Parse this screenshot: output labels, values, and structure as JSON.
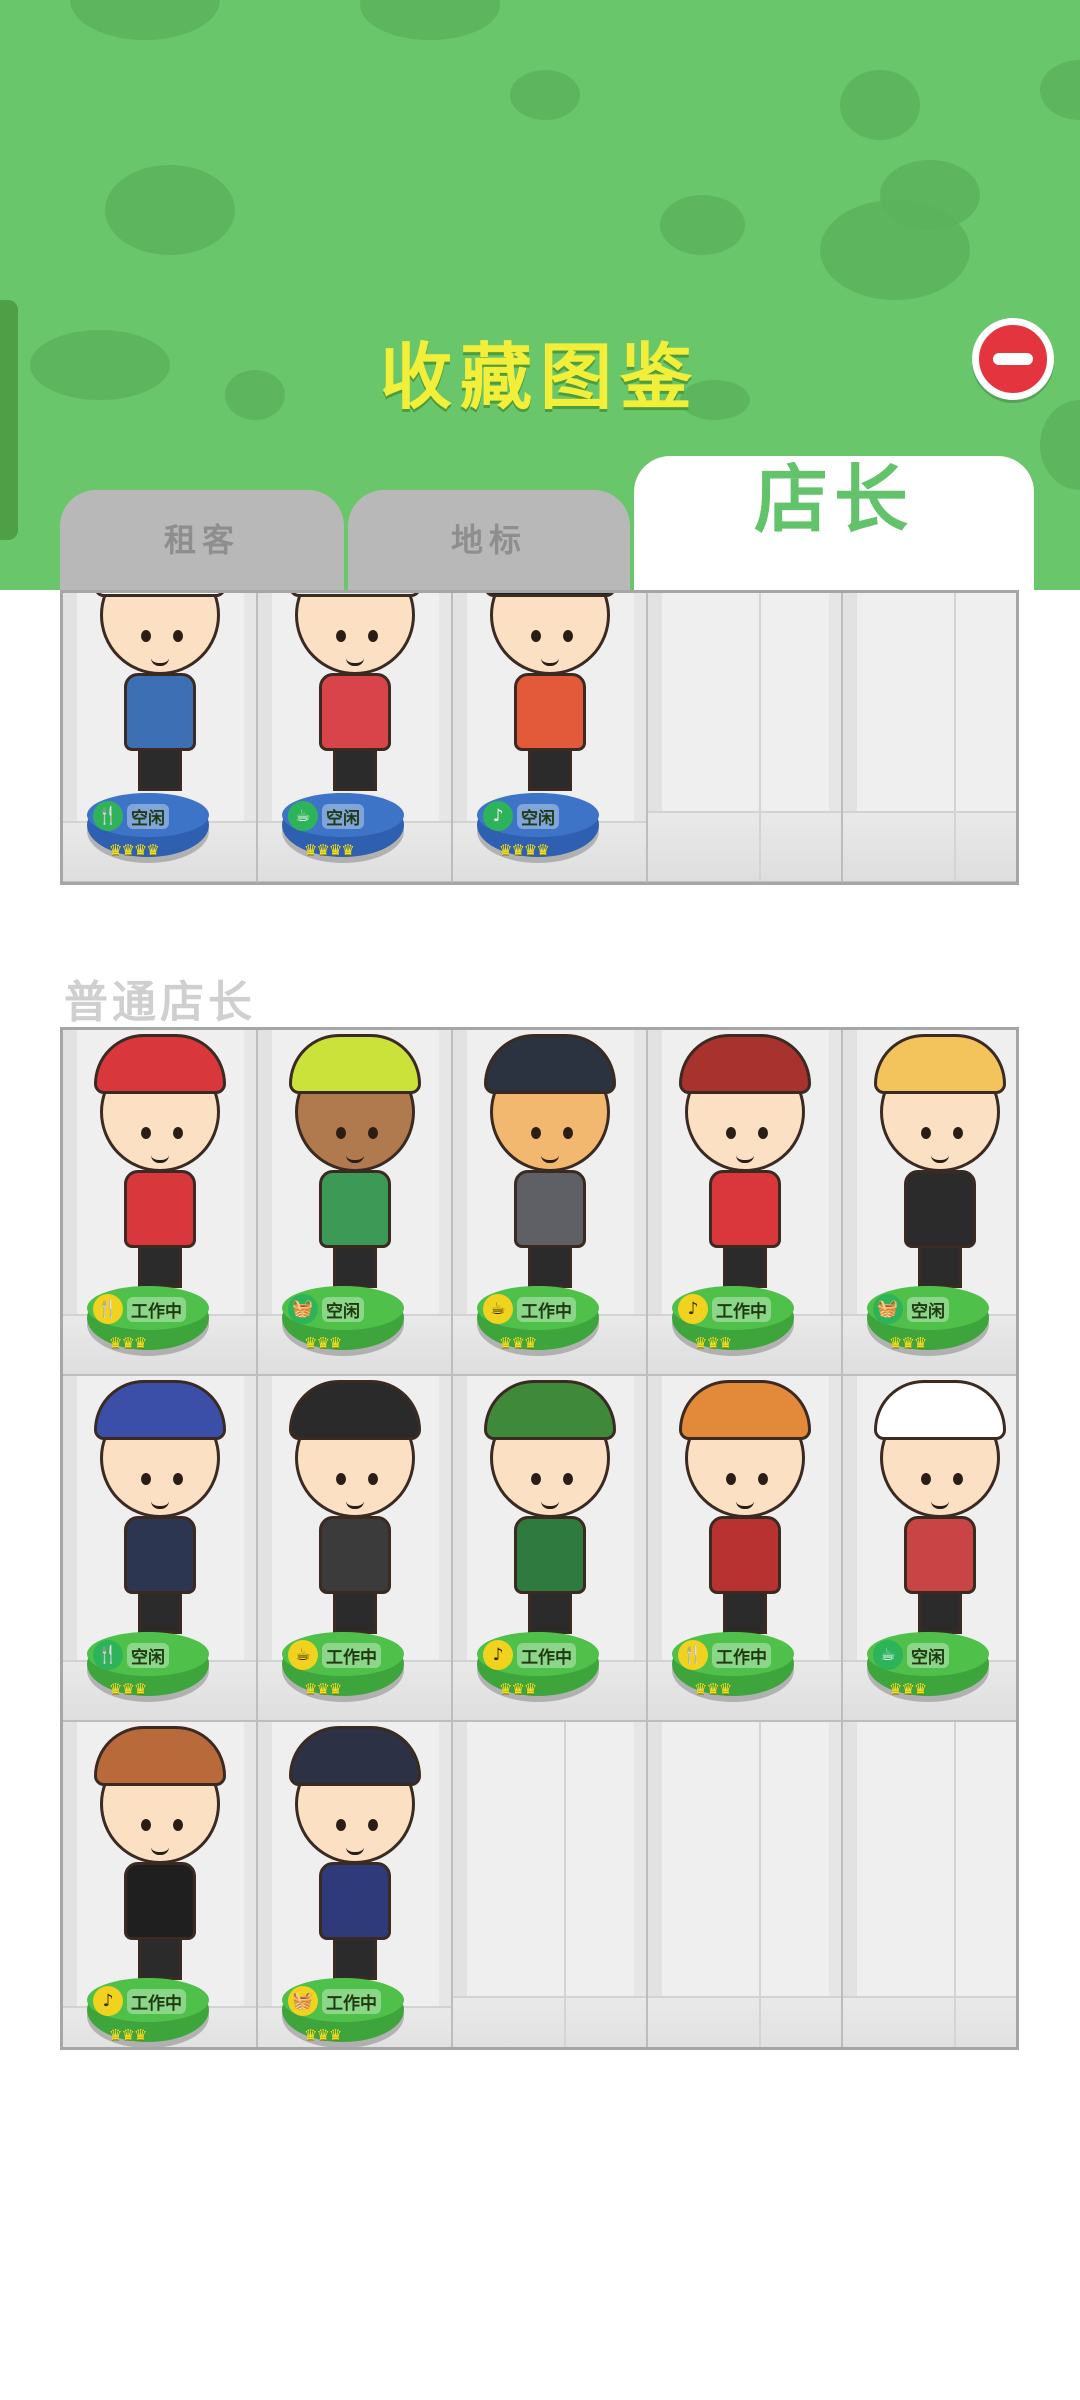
{
  "header": {
    "title": "收藏图鉴",
    "close_icon": "minus-circle-icon",
    "bg_color": "#6ac66a",
    "title_color": "#f2ef3a"
  },
  "tabs": [
    {
      "label": "租客",
      "active": false
    },
    {
      "label": "地标",
      "active": false
    },
    {
      "label": "店长",
      "active": true
    }
  ],
  "top_grid": {
    "slots": [
      {
        "filled": true,
        "status": "空闲",
        "icon": "fork-knife-icon",
        "ped": "blue",
        "crowns": "♛♛♛♛",
        "hair": "#3a2a22",
        "skin": "#fbe0c4",
        "shirt": "#3d6fb4",
        "hat": "#ffffff"
      },
      {
        "filled": true,
        "status": "空闲",
        "icon": "mug-icon",
        "ped": "blue",
        "crowns": "♛♛♛♛",
        "hair": "#c9662f",
        "skin": "#fbe0c4",
        "shirt": "#d9444a",
        "hat": "#e8eef7"
      },
      {
        "filled": true,
        "status": "空闲",
        "icon": "music-note-icon",
        "ped": "blue",
        "crowns": "♛♛♛♛",
        "hair": "#1f1f2a",
        "skin": "#fbe0c4",
        "shirt": "#e25a3a",
        "hat": "#1f1f2a"
      },
      {
        "filled": false
      },
      {
        "filled": false
      }
    ]
  },
  "section": {
    "title": "普通店长"
  },
  "main_grid": {
    "slots": [
      {
        "filled": true,
        "status": "工作中",
        "icon": "fork-knife-icon",
        "ped": "green",
        "crowns": "♛♛♛",
        "hair": "#3a2a22",
        "skin": "#fbe0c4",
        "shirt": "#d8373b",
        "hat": "#d8373b"
      },
      {
        "filled": true,
        "status": "空闲",
        "icon": "basket-icon",
        "ped": "green",
        "crowns": "♛♛♛",
        "hair": "#3a2a22",
        "skin": "#b07a4e",
        "shirt": "#3c9a56",
        "hat": "#cbe23a"
      },
      {
        "filled": true,
        "status": "工作中",
        "icon": "mug-icon",
        "ped": "green",
        "crowns": "♛♛♛",
        "hair": "#2a1d16",
        "skin": "#f2b870",
        "shirt": "#5f5f66",
        "hat": "#2b3240"
      },
      {
        "filled": true,
        "status": "工作中",
        "icon": "music-note-icon",
        "ped": "green",
        "crowns": "♛♛♛",
        "hair": "#3a2a22",
        "skin": "#fbe0c4",
        "shirt": "#d9373b",
        "hat": "#a8322e"
      },
      {
        "filled": true,
        "status": "空闲",
        "icon": "basket-icon",
        "ped": "green",
        "crowns": "♛♛♛",
        "hair": "#f4c45c",
        "skin": "#fbe0c4",
        "shirt": "#2b2b2b",
        "hat": "#f4c45c"
      },
      {
        "filled": true,
        "status": "空闲",
        "icon": "fork-knife-icon",
        "ped": "green",
        "crowns": "♛♛♛",
        "hair": "#3b4fa8",
        "skin": "#fbe0c4",
        "shirt": "#2d3650",
        "hat": "#3b4fa8"
      },
      {
        "filled": true,
        "status": "工作中",
        "icon": "mug-icon",
        "ped": "green",
        "crowns": "♛♛♛",
        "hair": "#2a2a2a",
        "skin": "#fbe0c4",
        "shirt": "#3b3b3b",
        "hat": "#2a2a2a"
      },
      {
        "filled": true,
        "status": "工作中",
        "icon": "music-note-icon",
        "ped": "green",
        "crowns": "♛♛♛",
        "hair": "#4a3322",
        "skin": "#fbe0c4",
        "shirt": "#2f7a3e",
        "hat": "#3e8a3a"
      },
      {
        "filled": true,
        "status": "工作中",
        "icon": "fork-knife-icon",
        "ped": "green",
        "crowns": "♛♛♛",
        "hair": "#e38a3a",
        "skin": "#fbe0c4",
        "shirt": "#b83232",
        "hat": "#e38a3a"
      },
      {
        "filled": true,
        "status": "空闲",
        "icon": "mug-icon",
        "ped": "green",
        "crowns": "♛♛♛",
        "hair": "#9a6a3e",
        "skin": "#fbe0c4",
        "shirt": "#c94444",
        "hat": "#ffffff"
      },
      {
        "filled": true,
        "status": "工作中",
        "icon": "music-note-icon",
        "ped": "green",
        "crowns": "♛♛♛",
        "hair": "#b86a3a",
        "skin": "#fbe0c4",
        "shirt": "#1f1f1f",
        "hat": "#b86a3a"
      },
      {
        "filled": true,
        "status": "工作中",
        "icon": "basket-icon",
        "ped": "green",
        "crowns": "♛♛♛",
        "hair": "#2d3145",
        "skin": "#fbe0c4",
        "shirt": "#2f3a7a",
        "hat": "#2d3145"
      },
      {
        "filled": false
      },
      {
        "filled": false
      },
      {
        "filled": false
      }
    ]
  },
  "colors": {
    "ped_blue": "#2f5fb0",
    "ped_blue_top": "#3e74c8",
    "ped_green": "#3ea53c",
    "ped_green_top": "#4fc04a",
    "status_icon_green": "#2db35a",
    "status_icon_yellow": "#f0d21f"
  }
}
